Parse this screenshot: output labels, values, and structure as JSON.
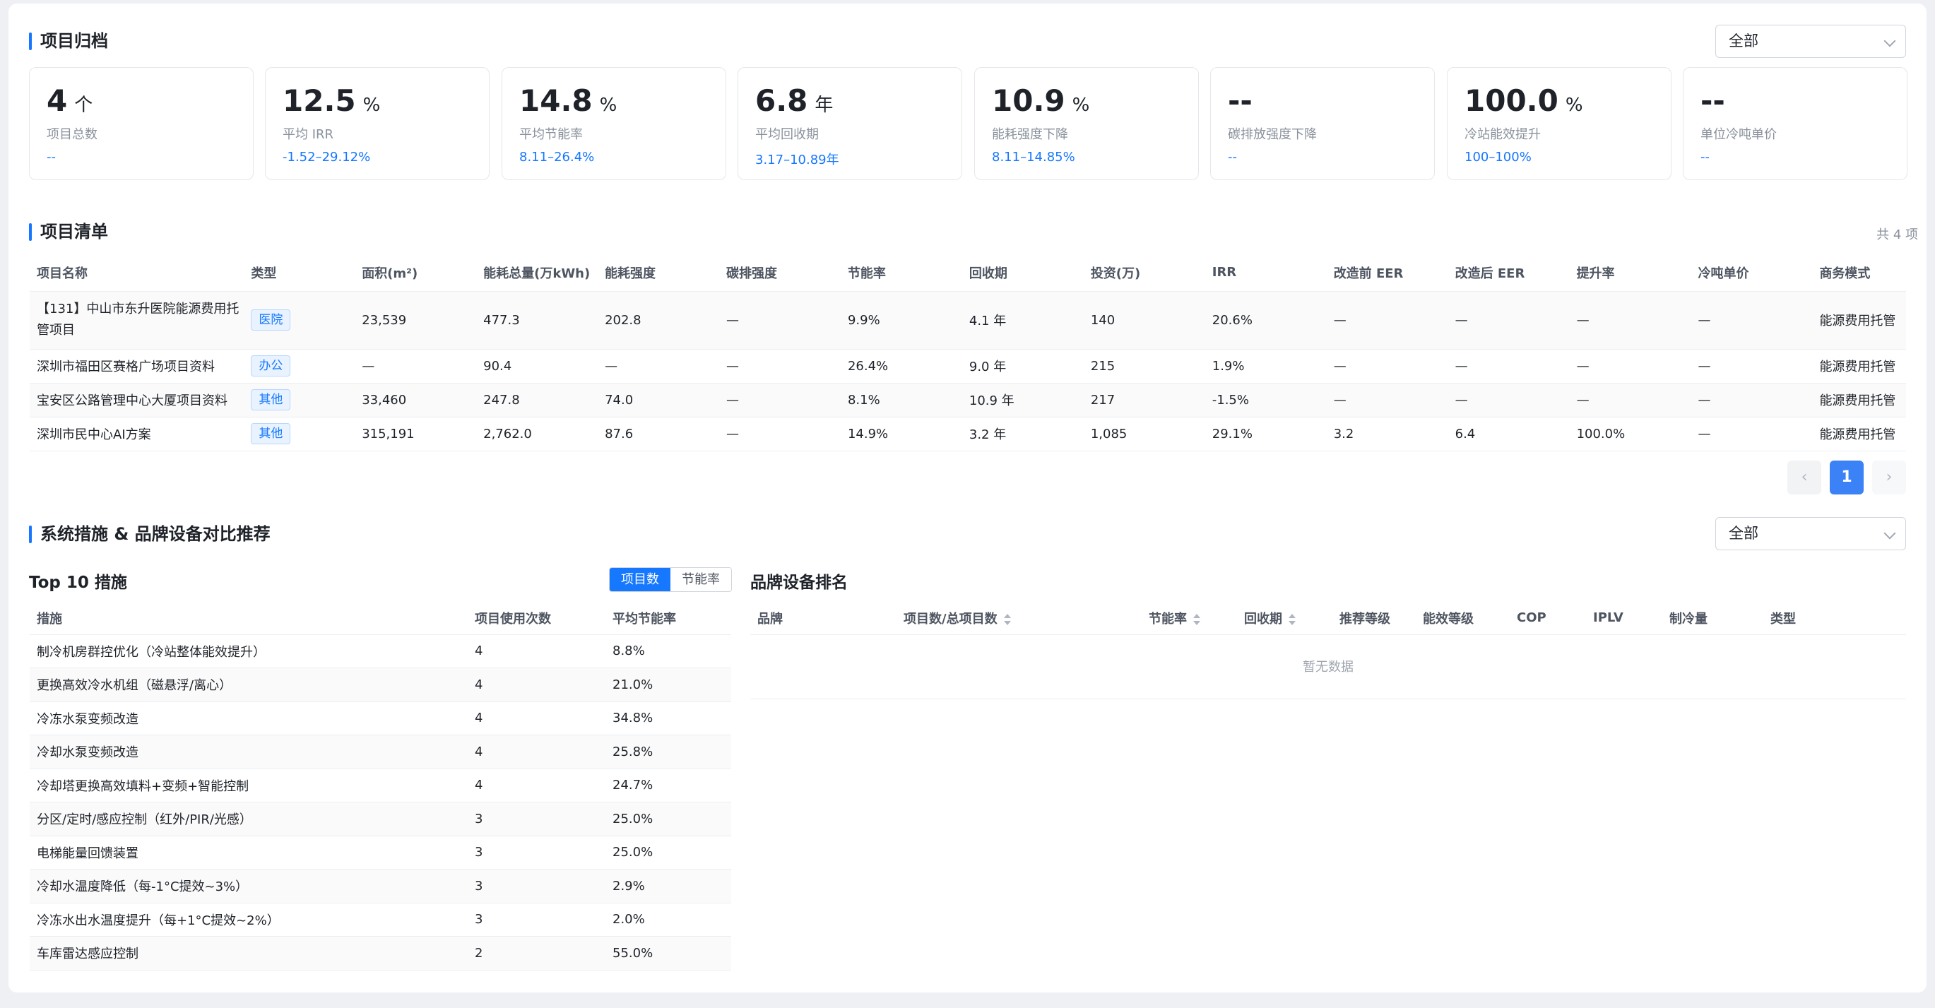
{
  "archive": {
    "title": "项目归档",
    "filter": "全部",
    "stats": [
      {
        "value": "4",
        "unit": "个",
        "label": "项目总数",
        "range": "--"
      },
      {
        "value": "12.5",
        "unit": "%",
        "label": "平均 IRR",
        "range": "-1.52–29.12%"
      },
      {
        "value": "14.8",
        "unit": "%",
        "label": "平均节能率",
        "range": "8.11–26.4%"
      },
      {
        "value": "6.8",
        "unit": "年",
        "label": "平均回收期",
        "range": "3.17–10.89年"
      },
      {
        "value": "10.9",
        "unit": "%",
        "label": "能耗强度下降",
        "range": "8.11–14.85%"
      },
      {
        "value": "--",
        "unit": "",
        "label": "碳排放强度下降",
        "range": "--"
      },
      {
        "value": "100.0",
        "unit": "%",
        "label": "冷站能效提升",
        "range": "100–100%"
      },
      {
        "value": "--",
        "unit": "",
        "label": "单位冷吨单价",
        "range": "--"
      }
    ]
  },
  "project_list": {
    "title": "项目清单",
    "total": "共 4 项",
    "columns": [
      "项目名称",
      "类型",
      "面积(m²)",
      "能耗总量(万kWh)",
      "能耗强度",
      "碳排强度",
      "节能率",
      "回收期",
      "投资(万)",
      "IRR",
      "改造前 EER",
      "改造后 EER",
      "提升率",
      "冷吨单价",
      "商务模式"
    ],
    "rows": [
      {
        "name": "【131】中山市东升医院能源费用托管项目",
        "type": "医院",
        "area": "23,539",
        "energy": "477.3",
        "intensity": "202.8",
        "carbon": "—",
        "saving": "9.9%",
        "payback": "4.1 年",
        "invest": "140",
        "irr": "20.6%",
        "eer_before": "—",
        "eer_after": "—",
        "improve": "—",
        "ton_price": "—",
        "model": "能源费用托管"
      },
      {
        "name": "深圳市福田区赛格广场项目资料",
        "type": "办公",
        "area": "—",
        "energy": "90.4",
        "intensity": "—",
        "carbon": "—",
        "saving": "26.4%",
        "payback": "9.0 年",
        "invest": "215",
        "irr": "1.9%",
        "eer_before": "—",
        "eer_after": "—",
        "improve": "—",
        "ton_price": "—",
        "model": "能源费用托管"
      },
      {
        "name": "宝安区公路管理中心大厦项目资料",
        "type": "其他",
        "area": "33,460",
        "energy": "247.8",
        "intensity": "74.0",
        "carbon": "—",
        "saving": "8.1%",
        "payback": "10.9 年",
        "invest": "217",
        "irr": "-1.5%",
        "eer_before": "—",
        "eer_after": "—",
        "improve": "—",
        "ton_price": "—",
        "model": "能源费用托管"
      },
      {
        "name": "深圳市民中心AI方案",
        "type": "其他",
        "area": "315,191",
        "energy": "2,762.0",
        "intensity": "87.6",
        "carbon": "—",
        "saving": "14.9%",
        "payback": "3.2 年",
        "invest": "1,085",
        "irr": "29.1%",
        "eer_before": "3.2",
        "eer_after": "6.4",
        "improve": "100.0%",
        "ton_price": "—",
        "model": "能源费用托管"
      }
    ],
    "pagination": {
      "prev": "‹",
      "current": "1",
      "next": "›"
    }
  },
  "measures_section": {
    "title": "系统措施 & 品牌设备对比推荐",
    "filter": "全部",
    "top10": {
      "title": "Top 10 措施",
      "toggle": [
        "项目数",
        "节能率"
      ],
      "columns": [
        "措施",
        "项目使用次数",
        "平均节能率"
      ],
      "rows": [
        {
          "measure": "制冷机房群控优化（冷站整体能效提升）",
          "count": "4",
          "rate": "8.8%"
        },
        {
          "measure": "更换高效冷水机组（磁悬浮/离心）",
          "count": "4",
          "rate": "21.0%"
        },
        {
          "measure": "冷冻水泵变频改造",
          "count": "4",
          "rate": "34.8%"
        },
        {
          "measure": "冷却水泵变频改造",
          "count": "4",
          "rate": "25.8%"
        },
        {
          "measure": "冷却塔更换高效填料+变频+智能控制",
          "count": "4",
          "rate": "24.7%"
        },
        {
          "measure": "分区/定时/感应控制（红外/PIR/光感）",
          "count": "3",
          "rate": "25.0%"
        },
        {
          "measure": "电梯能量回馈装置",
          "count": "3",
          "rate": "25.0%"
        },
        {
          "measure": "冷却水温度降低（每-1°C提效~3%）",
          "count": "3",
          "rate": "2.9%"
        },
        {
          "measure": "冷冻水出水温度提升（每+1°C提效~2%）",
          "count": "3",
          "rate": "2.0%"
        },
        {
          "measure": "车库雷达感应控制",
          "count": "2",
          "rate": "55.0%"
        }
      ]
    },
    "brand": {
      "title": "品牌设备排名",
      "columns": [
        "品牌",
        "项目数/总项目数",
        "节能率",
        "回收期",
        "推荐等级",
        "能效等级",
        "COP",
        "IPLV",
        "制冷量",
        "类型"
      ],
      "empty": "暂无数据"
    }
  }
}
